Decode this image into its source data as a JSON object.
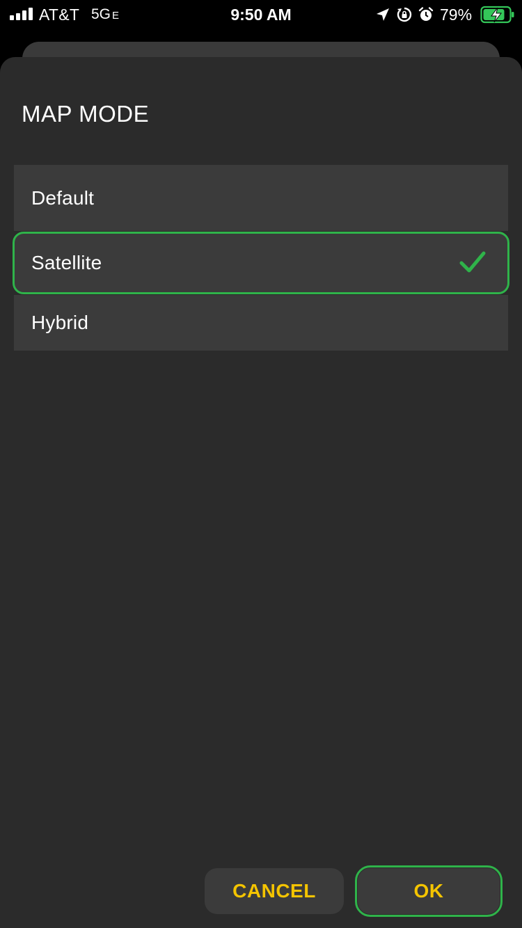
{
  "status_bar": {
    "carrier": "AT&T",
    "network": "5G",
    "network_suffix": "E",
    "time": "9:50 AM",
    "battery_percent": "79%",
    "icons": [
      "signal-icon",
      "location-arrow-icon",
      "rotation-lock-icon",
      "alarm-icon",
      "battery-charging-icon"
    ]
  },
  "dialog": {
    "title": "MAP MODE",
    "options": [
      {
        "label": "Default",
        "selected": false
      },
      {
        "label": "Satellite",
        "selected": true
      },
      {
        "label": "Hybrid",
        "selected": false
      }
    ],
    "selected_icon": "checkmark-icon",
    "buttons": {
      "cancel": "CANCEL",
      "ok": "OK"
    }
  },
  "colors": {
    "background": "#2b2b2b",
    "option_background": "#3b3b3b",
    "button_text": "#f4c400",
    "highlight": "#2fb34a",
    "checkmark": "#2fb34a",
    "battery": "#34c759"
  }
}
